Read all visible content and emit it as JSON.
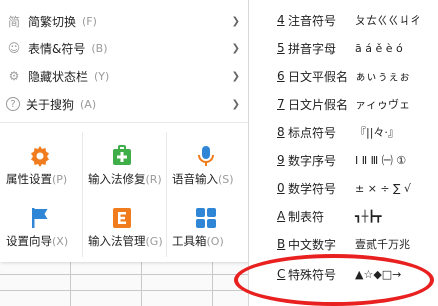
{
  "menu": {
    "items": [
      {
        "label": "简繁切换",
        "key": "(F)",
        "icon": "traditional-char-icon",
        "icon_glyph": "简"
      },
      {
        "label": "表情&符号",
        "key": "(B)",
        "icon": "smiley-icon",
        "icon_glyph": "☺"
      },
      {
        "label": "隐藏状态栏",
        "key": "(Y)",
        "icon": "toggle-icon",
        "icon_glyph": "⚙"
      },
      {
        "label": "关于搜狗",
        "key": "(A)",
        "icon": "question-icon",
        "icon_glyph": "?"
      }
    ]
  },
  "tools": [
    {
      "label": "属性设置",
      "key": "(P)",
      "icon": "gear-icon"
    },
    {
      "label": "输入法修复",
      "key": "(R)",
      "icon": "repair-kit-icon"
    },
    {
      "label": "语音输入",
      "key": "(S)",
      "icon": "microphone-icon"
    },
    {
      "label": "设置向导",
      "key": "(X)",
      "icon": "flag-icon"
    },
    {
      "label": "输入法管理",
      "key": "(G)",
      "icon": "manager-icon"
    },
    {
      "label": "工具箱",
      "key": "(O)",
      "icon": "toolbox-icon"
    }
  ],
  "submenu": [
    {
      "num": "4",
      "name": "注音符号",
      "sample": "ㄆㄊㄍㄍㄐㄔ"
    },
    {
      "num": "5",
      "name": "拼音字母",
      "sample": "ā á ě è ó"
    },
    {
      "num": "6",
      "name": "日文平假名",
      "sample": "ぁぃぅぇぉ"
    },
    {
      "num": "7",
      "name": "日文片假名",
      "sample": "ァィゥヴェ"
    },
    {
      "num": "8",
      "name": "标点符号",
      "sample": "『||々·』"
    },
    {
      "num": "9",
      "name": "数字序号",
      "sample": "Ⅰ Ⅱ Ⅲ ㈠ ①"
    },
    {
      "num": "0",
      "name": "数学符号",
      "sample": "± × ÷ ∑ √"
    },
    {
      "num": "A",
      "name": "制表符",
      "sample": "┓┼┣┳"
    },
    {
      "num": "B",
      "name": "中文数字",
      "sample": "壹贰千万兆"
    },
    {
      "num": "C",
      "name": "特殊符号",
      "sample": "▲☆◆□→"
    }
  ],
  "colors": {
    "accent": "#f07c1e",
    "highlight": "#e8201f",
    "icon_blue": "#2f86d6",
    "icon_green": "#3fae49"
  }
}
